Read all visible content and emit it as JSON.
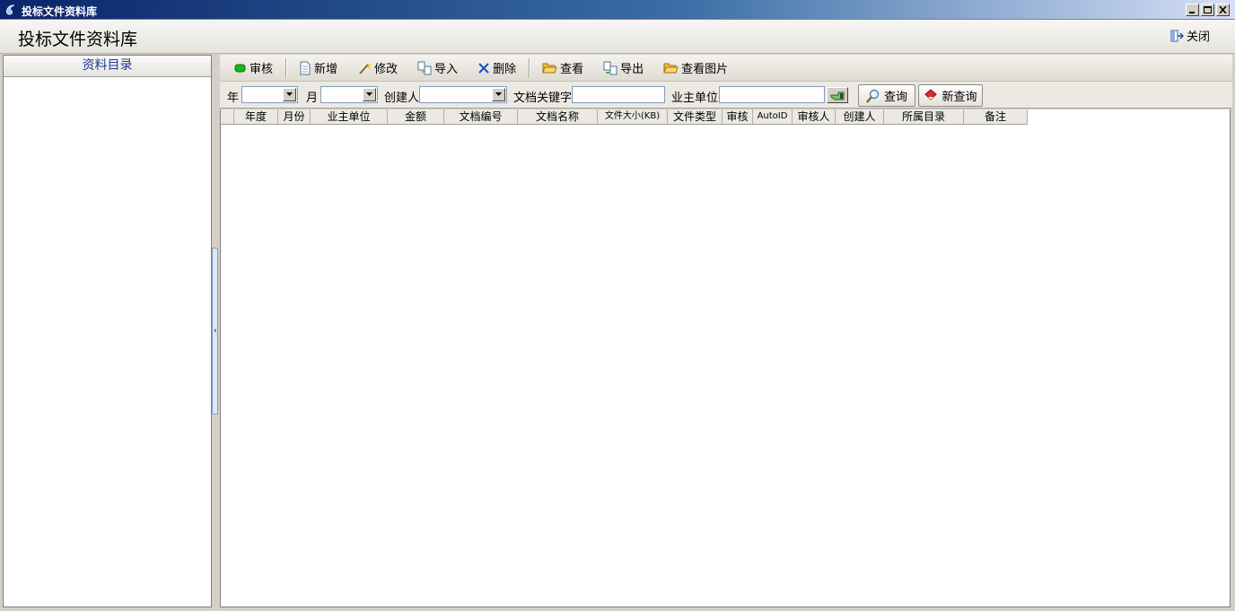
{
  "window": {
    "title": "投标文件资料库",
    "app_icon": "swirl-icon"
  },
  "header": {
    "title": "投标文件资料库",
    "close_label": "关闭"
  },
  "left_panel": {
    "title": "资料目录"
  },
  "toolbar": {
    "audit": "审核",
    "add": "新增",
    "edit": "修改",
    "import": "导入",
    "delete": "删除",
    "view": "查看",
    "export": "导出",
    "view_image": "查看图片"
  },
  "filters": {
    "year_label": "年",
    "year_value": "",
    "month_label": "月",
    "month_value": "",
    "creator_label": "创建人",
    "creator_value": "",
    "keyword_label": "文档关键字",
    "keyword_value": "",
    "owner_label": "业主单位",
    "owner_value": "",
    "query_label": "查询",
    "new_query_label": "新查询"
  },
  "grid": {
    "columns": [
      "",
      "年度",
      "月份",
      "业主单位",
      "金额",
      "文档编号",
      "文档名称",
      "文件大小(KB)",
      "文件类型",
      "审核",
      "AutoID",
      "审核人",
      "创建人",
      "所属目录",
      "备注"
    ],
    "rows": []
  }
}
